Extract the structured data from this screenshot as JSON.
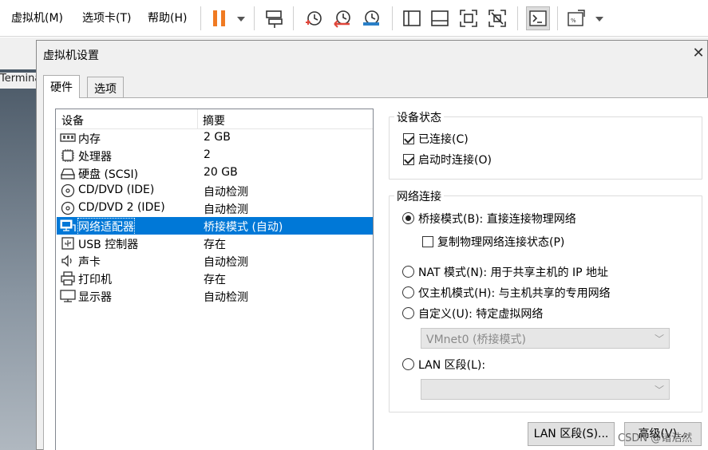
{
  "menu": {
    "vm": "虚拟机(M)",
    "tabs": "选项卡(T)",
    "help": "帮助(H)"
  },
  "toolbar_icons": [
    "pause-icon",
    "dropdown-icon",
    "send-keys-icon",
    "snapshot-take-icon",
    "snapshot-revert-icon",
    "snapshot-manager-icon",
    "sidebar-icon",
    "thumbnail-icon",
    "fullscreen-icon",
    "unity-icon",
    "terminal-icon",
    "view-stretch-icon"
  ],
  "background": {
    "terminal_label": "Termina"
  },
  "dialog": {
    "title": "虚拟机设置",
    "close": "✕",
    "tabs": {
      "hardware": "硬件",
      "options": "选项"
    }
  },
  "device_list": {
    "header": {
      "device": "设备",
      "summary": "摘要"
    },
    "items": [
      {
        "name": "内存",
        "summary": "2 GB",
        "icon": "memory-icon"
      },
      {
        "name": "处理器",
        "summary": "2",
        "icon": "cpu-icon"
      },
      {
        "name": "硬盘 (SCSI)",
        "summary": "20 GB",
        "icon": "harddisk-icon"
      },
      {
        "name": "CD/DVD (IDE)",
        "summary": "自动检测",
        "icon": "cd-dvd-icon"
      },
      {
        "name": "CD/DVD 2 (IDE)",
        "summary": "自动检测",
        "icon": "cd-dvd-icon"
      },
      {
        "name": "网络适配器",
        "summary": "桥接模式 (自动)",
        "icon": "network-adapter-icon"
      },
      {
        "name": "USB 控制器",
        "summary": "存在",
        "icon": "usb-icon"
      },
      {
        "name": "声卡",
        "summary": "自动检测",
        "icon": "speaker-icon"
      },
      {
        "name": "打印机",
        "summary": "存在",
        "icon": "printer-icon"
      },
      {
        "name": "显示器",
        "summary": "自动检测",
        "icon": "monitor-icon"
      }
    ],
    "selected_index": 5
  },
  "device_status": {
    "title": "设备状态",
    "connected": {
      "label": "已连接(C)",
      "checked": true
    },
    "connect_at_power_on": {
      "label": "启动时连接(O)",
      "checked": true
    }
  },
  "network": {
    "title": "网络连接",
    "bridged": {
      "label": "桥接模式(B): 直接连接物理网络",
      "selected": true
    },
    "replicate": {
      "label": "复制物理网络连接状态(P)",
      "checked": false
    },
    "nat": {
      "label": "NAT 模式(N): 用于共享主机的 IP 地址",
      "selected": false
    },
    "host_only": {
      "label": "仅主机模式(H): 与主机共享的专用网络",
      "selected": false
    },
    "custom": {
      "label": "自定义(U): 特定虚拟网络",
      "selected": false
    },
    "custom_value": "VMnet0 (桥接模式)",
    "lan_segment": {
      "label": "LAN 区段(L):",
      "selected": false
    },
    "lan_value": ""
  },
  "buttons": {
    "lan_segments": "LAN 区段(S)...",
    "advanced": "高级(V)..."
  },
  "watermark": "CSDN @诸浩然",
  "colors": {
    "accent": "#0078d7",
    "pause": "#f07a22",
    "snapshot_red": "#e0463a",
    "snapshot_blue": "#2a7fc7"
  }
}
